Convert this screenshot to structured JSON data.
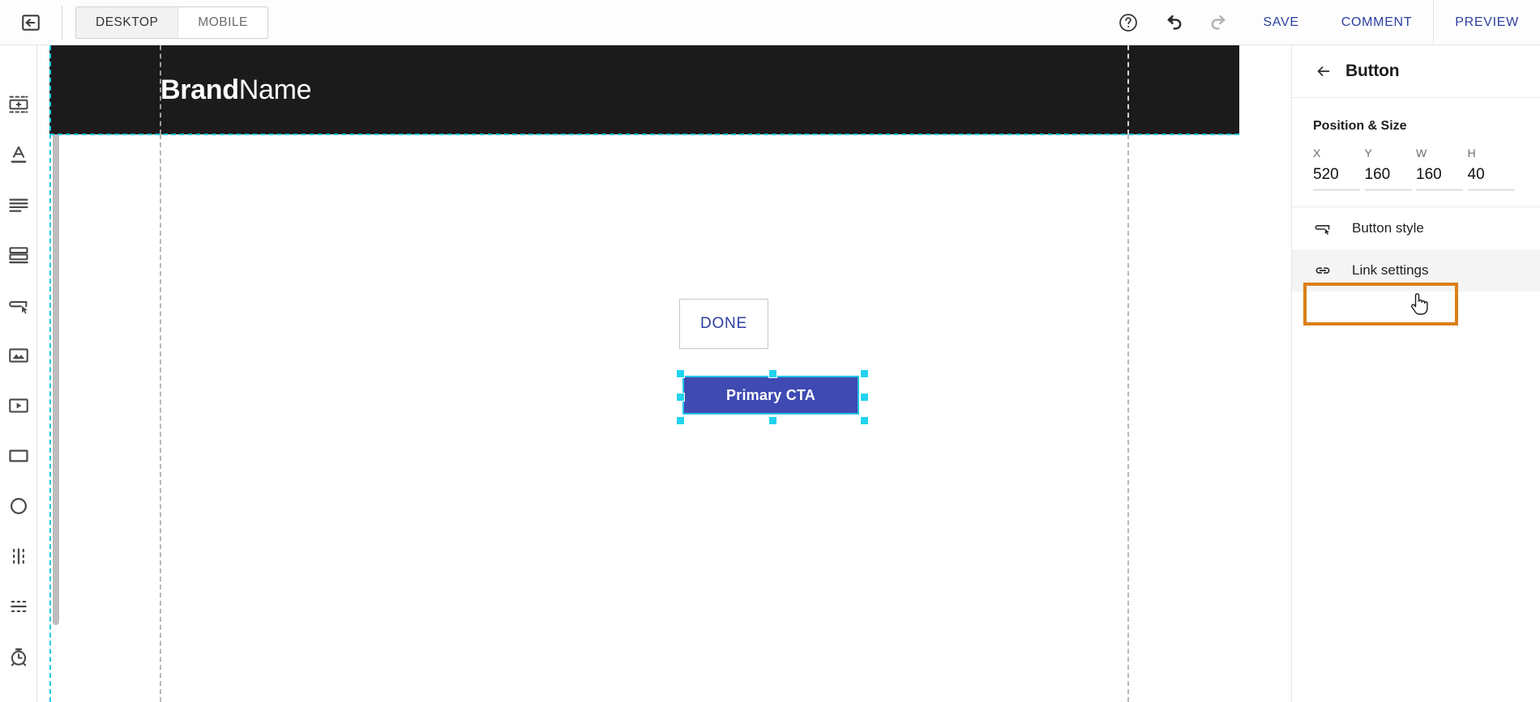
{
  "topbar": {
    "back_icon": "back-arrow-icon",
    "tabs": [
      {
        "label": "DESKTOP",
        "active": true
      },
      {
        "label": "MOBILE",
        "active": false
      }
    ],
    "help_icon": "help-circle-icon",
    "undo_icon": "undo-icon",
    "redo_icon": "redo-icon",
    "actions": [
      {
        "label": "SAVE",
        "name": "save-button"
      },
      {
        "label": "COMMENT",
        "name": "comment-button"
      },
      {
        "label": "PREVIEW",
        "name": "preview-button"
      }
    ],
    "accent_color": "#2b3fa0"
  },
  "sidebar": {
    "items": [
      {
        "icon": "add-section-icon",
        "name": "sidebar-item-add-section"
      },
      {
        "icon": "text-icon",
        "name": "sidebar-item-text"
      },
      {
        "icon": "paragraph-icon",
        "name": "sidebar-item-paragraph"
      },
      {
        "icon": "stacked-blocks-icon",
        "name": "sidebar-item-blocks"
      },
      {
        "icon": "button-icon",
        "name": "sidebar-item-button"
      },
      {
        "icon": "image-icon",
        "name": "sidebar-item-image"
      },
      {
        "icon": "video-icon",
        "name": "sidebar-item-video"
      },
      {
        "icon": "rectangle-icon",
        "name": "sidebar-item-rectangle"
      },
      {
        "icon": "circle-icon",
        "name": "sidebar-item-circle"
      },
      {
        "icon": "divider-vertical-icon",
        "name": "sidebar-item-vertical-divider"
      },
      {
        "icon": "divider-horizontal-icon",
        "name": "sidebar-item-horizontal-divider"
      },
      {
        "icon": "timer-icon",
        "name": "sidebar-item-timer"
      }
    ]
  },
  "canvas": {
    "brand_bold": "Brand",
    "brand_light": "Name",
    "header_background": "#1b1b1b",
    "guide_color": "#22c6e8",
    "done_button": {
      "label": "DONE",
      "text_color": "#2b3fa0",
      "border_color": "#c6c6c6"
    },
    "cta_button": {
      "label": "Primary CTA",
      "background": "#3f4ab3",
      "text_color": "#ffffff",
      "selected": true,
      "handle_color": "#22d3f0"
    }
  },
  "panel": {
    "back_icon": "back-arrow-icon",
    "title": "Button",
    "section_title": "Position & Size",
    "fields": [
      {
        "label": "X",
        "value": "520",
        "name": "position-x-input"
      },
      {
        "label": "Y",
        "value": "160",
        "name": "position-y-input"
      },
      {
        "label": "W",
        "value": "160",
        "name": "width-input"
      },
      {
        "label": "H",
        "value": "40",
        "name": "height-input"
      }
    ],
    "menu": [
      {
        "label": "Button style",
        "icon": "button-style-icon",
        "name": "menu-item-button-style",
        "highlighted": false
      },
      {
        "label": "Link settings",
        "icon": "link-icon",
        "name": "menu-item-link-settings",
        "highlighted": true
      }
    ],
    "highlight_color": "#db7f16"
  }
}
